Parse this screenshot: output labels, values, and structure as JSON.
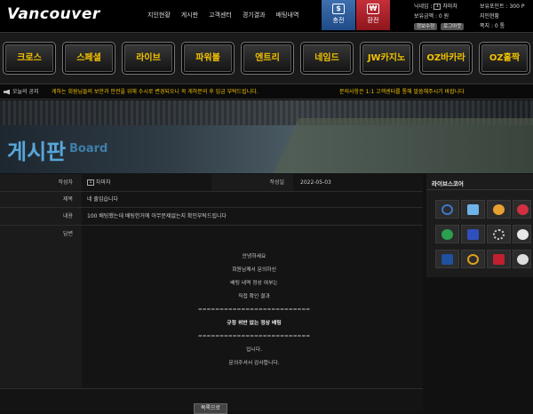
{
  "header": {
    "logo": "Vancouver",
    "nav": [
      "지인현황",
      "게시판",
      "고객센터",
      "경기결과",
      "배팅내역"
    ],
    "charge_label": "충전",
    "refund_label": "환전",
    "user": {
      "nickname_label": "닉네임 :",
      "level_badge": "1",
      "nickname": "차마차",
      "money_label": "보유금액 : 0 원",
      "btn_info": "정보수정",
      "btn_logout": "로그아웃",
      "point_label": "보유포인트 :",
      "point_value": "300 P",
      "friend_label": "지인현황",
      "coupon_label": "쪽지 : 0 통"
    }
  },
  "menu": [
    "크로스",
    "스페셜",
    "라이브",
    "파워볼",
    "엔트리",
    "네임드",
    "JW카지노",
    "OZ바카라",
    "OZ홀짝"
  ],
  "notice": {
    "label": "오늘의 공지",
    "text1": "게하는 회원님들의 보안과 안전을 위해 수시로 변경되오니 꼭 게하문의 후 입금 부탁드립니다.",
    "text2": "문의사항은 1:1 고객센터를 통해 말씀해주시기 바랍니다"
  },
  "banner": {
    "title": "게시판",
    "subtitle": "Board"
  },
  "post": {
    "author_label": "작성자",
    "author_level": "1",
    "author": "차마차",
    "date_label": "작성일",
    "date": "2022-05-03",
    "title_label": "제목",
    "title": "네 출입습니다",
    "content_label": "내용",
    "content": "100 배팅했는데 배팅한거에 아무문제없는지 확인부탁드립니다",
    "reply_label": "답변",
    "reply_lines": [
      "안녕하세요",
      "회원님께서 문의하신",
      "배팅 내역 정상 여부는",
      "직접 확인 결과",
      "==========================",
      "규정 위반 없는 정상 배팅",
      "==========================",
      "입니다.",
      "문의주셔서 감사합니다."
    ]
  },
  "list_button": "목록으로",
  "live_score": {
    "title": "라이브스코어",
    "icons": [
      {
        "name": "spin-icon",
        "color": "#3c78c8"
      },
      {
        "name": "7m-icon",
        "color": "#6fb4e8"
      },
      {
        "name": "goal-icon",
        "color": "#e8a030"
      },
      {
        "name": "circles-icon",
        "color": "#d03040"
      },
      {
        "name": "n-icon",
        "color": "#2aa050"
      },
      {
        "name": "score-icon",
        "color": "#3050c0"
      },
      {
        "name": "ucl-icon",
        "color": "#cccccc"
      },
      {
        "name": "laliga-icon",
        "color": "#e8e8e8"
      },
      {
        "name": "mlb-icon",
        "color": "#2050a0"
      },
      {
        "name": "circle-icon",
        "color": "#e0a020"
      },
      {
        "name": "nba-icon",
        "color": "#c02030"
      },
      {
        "name": "nhl-icon",
        "color": "#dddddd"
      }
    ]
  }
}
